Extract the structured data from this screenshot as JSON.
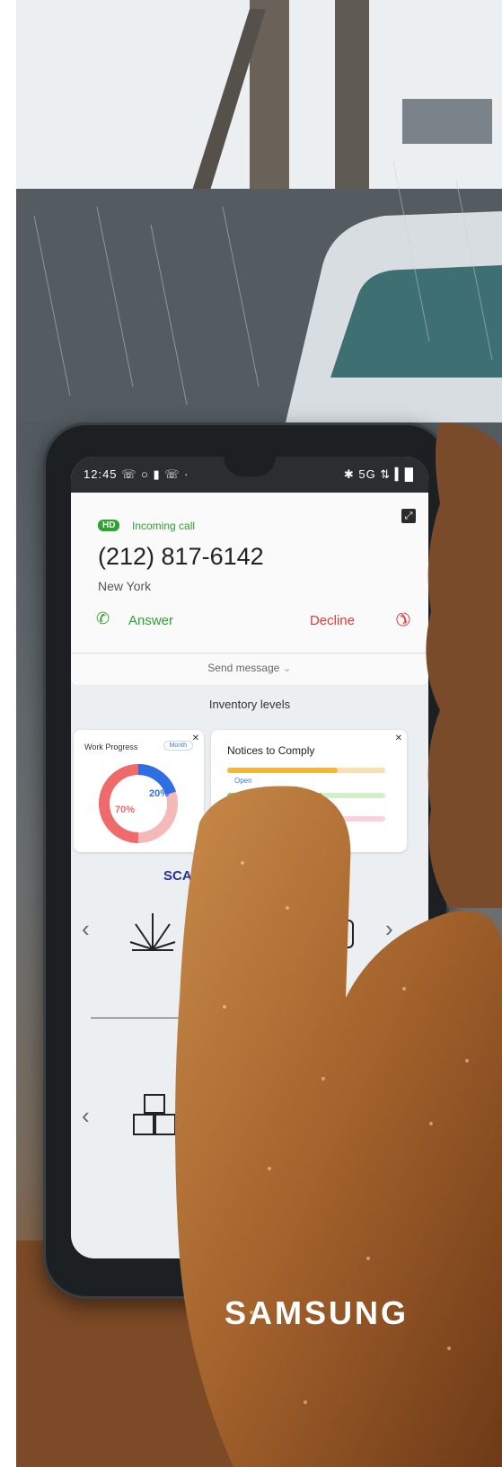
{
  "status_bar": {
    "time": "12:45",
    "left_icons": "☏ ○ ▮ ☏ ·",
    "right_icons": "✱ 5G ⇅ ▍█"
  },
  "call": {
    "badge": "HD",
    "status": "Incoming call",
    "number": "(212) 817-6142",
    "location": "New York",
    "answer_label": "Answer",
    "decline_label": "Decline",
    "send_message": "Send message"
  },
  "inventory_label": "Inventory levels",
  "work_progress": {
    "title": "Work Progress",
    "period": "Month",
    "completed_pct": "20%",
    "remaining_pct": "70%",
    "completed_value": 20,
    "remaining_value": 70
  },
  "notices": {
    "title": "Notices to Comply",
    "status": "Open",
    "bars": [
      {
        "color": "#f5b63a",
        "fill": 0.7
      },
      {
        "color": "#7bd36d",
        "fill": 0.6
      },
      {
        "color": "#f08aa0",
        "fill": 0.5
      }
    ]
  },
  "scan_label": "SCA",
  "brand": "SAMSUNG",
  "colors": {
    "answer": "#2ea32e",
    "decline": "#e43b35",
    "progress_blue": "#2f6fe4",
    "progress_red": "#ef6a6a"
  }
}
